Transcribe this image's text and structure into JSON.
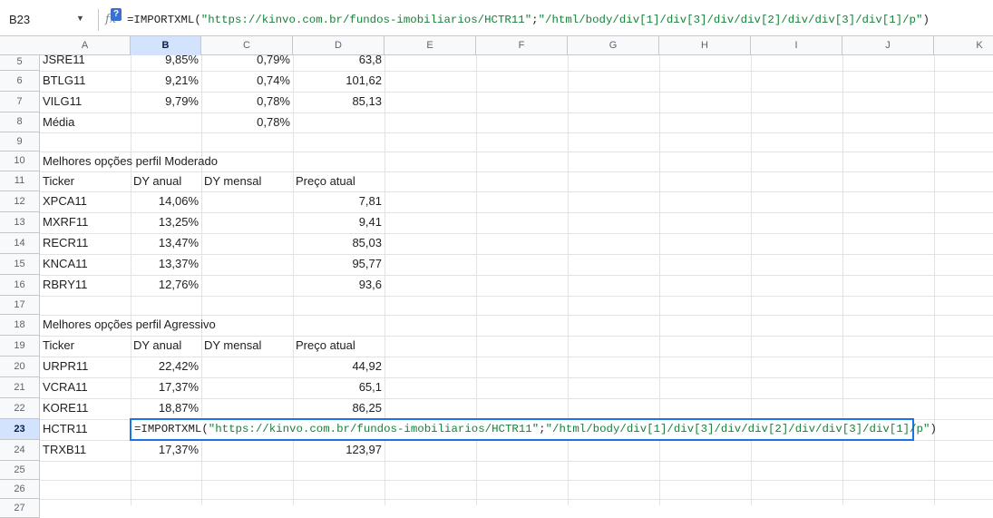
{
  "name_box": "B23",
  "formula": {
    "prefix": "=IMPORTXML(",
    "url": "\"https://kinvo.com.br/fundos-imobiliarios/HCTR11\"",
    "sep": ";",
    "xpath": "\"/html/body/div[1]/div[3]/div/div[2]/div/div[3]/div[1]/p\"",
    "suffix": ")"
  },
  "columns": [
    "A",
    "B",
    "C",
    "D",
    "E",
    "F",
    "G",
    "H",
    "I",
    "J",
    "K"
  ],
  "rows": [
    "5",
    "6",
    "7",
    "8",
    "9",
    "10",
    "11",
    "12",
    "13",
    "14",
    "15",
    "16",
    "17",
    "18",
    "19",
    "20",
    "21",
    "22",
    "23",
    "24",
    "25",
    "26",
    "27"
  ],
  "cells": {
    "r5": {
      "a": "JSRE11",
      "b": "9,85%",
      "c": "0,79%",
      "d": "63,8"
    },
    "r6": {
      "a": "BTLG11",
      "b": "9,21%",
      "c": "0,74%",
      "d": "101,62"
    },
    "r7": {
      "a": "VILG11",
      "b": "9,79%",
      "c": "0,78%",
      "d": "85,13"
    },
    "r8": {
      "a": "Média",
      "c": "0,78%"
    },
    "r10": {
      "a": "Melhores opções perfil Moderado"
    },
    "r11": {
      "a": "Ticker",
      "b": "DY anual",
      "c": "DY mensal",
      "d": "Preço atual"
    },
    "r12": {
      "a": "XPCA11",
      "b": "14,06%",
      "d": "7,81"
    },
    "r13": {
      "a": "MXRF11",
      "b": "13,25%",
      "d": "9,41"
    },
    "r14": {
      "a": "RECR11",
      "b": "13,47%",
      "d": "85,03"
    },
    "r15": {
      "a": "KNCA11",
      "b": "13,37%",
      "d": "95,77"
    },
    "r16": {
      "a": "RBRY11",
      "b": "12,76%",
      "d": "93,6"
    },
    "r18": {
      "a": "Melhores opções perfil Agressivo"
    },
    "r19": {
      "a": "Ticker",
      "b": "DY anual",
      "c": "DY mensal",
      "d": "Preço atual"
    },
    "r20": {
      "a": "URPR11",
      "b": "22,42%",
      "d": "44,92"
    },
    "r21": {
      "a": "VCRA11",
      "b": "17,37%",
      "d": "65,1"
    },
    "r22": {
      "a": "KORE11",
      "b": "18,87%",
      "d": "86,25"
    },
    "r23": {
      "a": "HCTR11"
    },
    "r24": {
      "a": "TRXB11",
      "b": "17,37%",
      "d": "123,97"
    }
  }
}
